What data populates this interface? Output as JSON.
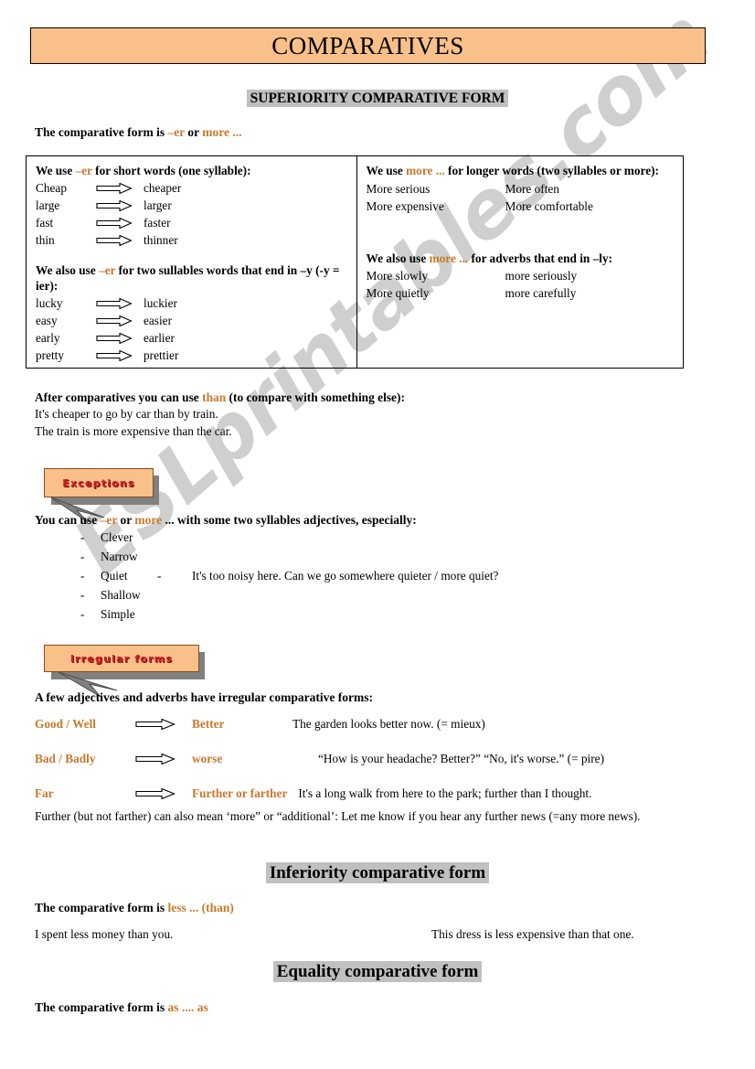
{
  "page": {
    "title": "COMPARATIVES",
    "watermark": "ESLprintables.com",
    "colors": {
      "title_bg": "#f9c08a",
      "heading_highlight": "#c0c0c0",
      "accent_orange": "#c9792b",
      "badge_bg": "#f9c08a",
      "badge_text": "#d12020",
      "shadow": "#808080"
    }
  },
  "superiority": {
    "heading": "SUPERIORITY COMPARATIVE FORM",
    "lead_prefix": "The comparative form is ",
    "lead_accent1": "–er",
    "lead_mid": " or ",
    "lead_accent2": "more ...",
    "table": {
      "left": {
        "header_part1": "We use ",
        "header_accent": "–er",
        "header_part2": " for short words (one syllable):",
        "pairs": [
          {
            "base": "Cheap",
            "comparative": "cheaper"
          },
          {
            "base": "large",
            "comparative": "larger"
          },
          {
            "base": "fast",
            "comparative": "faster"
          },
          {
            "base": "thin",
            "comparative": "thinner"
          }
        ],
        "header2_part1": "We also use ",
        "header2_accent": "–er",
        "header2_part2": " for two sullables words that end in –y (-y = ier):",
        "pairs2": [
          {
            "base": "lucky",
            "comparative": "luckier"
          },
          {
            "base": "easy",
            "comparative": "easier"
          },
          {
            "base": "early",
            "comparative": "earlier"
          },
          {
            "base": "pretty",
            "comparative": "prettier"
          }
        ]
      },
      "right": {
        "header_part1": "We use ",
        "header_accent": "more ...",
        "header_part2": " for longer words (two syllables or more):",
        "words": [
          {
            "c1": "More serious",
            "c2": "More often"
          },
          {
            "c1": "More expensive",
            "c2": "More comfortable"
          }
        ],
        "header2_part1": "We also use ",
        "header2_accent": "more ...",
        "header2_part2": " for adverbs that end in –ly:",
        "words2": [
          {
            "c1": "More slowly",
            "c2": "more seriously"
          },
          {
            "c1": "More quietly",
            "c2": "more carefully"
          }
        ]
      }
    }
  },
  "after_comparatives": {
    "lead_part1": "After comparatives you can use ",
    "lead_accent": "than",
    "lead_part2": " (to compare with something else):",
    "examples": [
      "It's cheaper to go by car than by train.",
      "The train is more expensive than the car."
    ]
  },
  "exceptions": {
    "badge_label": "Exceptions",
    "lead_part1": "You can use ",
    "lead_accent1": "–er",
    "lead_mid": " or ",
    "lead_accent2": "more",
    "lead_part2": " ... with some two syllables adjectives, especially:",
    "items": [
      {
        "dash": "-",
        "word": "Clever",
        "sep": "",
        "note": ""
      },
      {
        "dash": "-",
        "word": "Narrow",
        "sep": "",
        "note": ""
      },
      {
        "dash": "-",
        "word": "Quiet",
        "sep": "-",
        "note": "It's too noisy here. Can we go somewhere quieter / more quiet?"
      },
      {
        "dash": "-",
        "word": "Shallow",
        "sep": "",
        "note": ""
      },
      {
        "dash": "-",
        "word": "Simple",
        "sep": "",
        "note": ""
      }
    ]
  },
  "irregular": {
    "badge_label": "Irregular forms",
    "lead": "A few adjectives and adverbs have irregular comparative forms:",
    "rows": [
      {
        "base": "Good / Well",
        "comparative": "Better",
        "example": "The garden looks better now. (= mieux)"
      },
      {
        "base": "Bad / Badly",
        "comparative": "worse",
        "example": "“How is your headache? Better?” “No, it's worse.” (= pire)"
      },
      {
        "base": "Far",
        "comparative": "Further or farther",
        "example": "It's a long walk from here to the park; further than I thought."
      }
    ],
    "note": "Further (but not farther) can also mean ‘more” or “additional’: Let me know if you hear any further news (=any more news)."
  },
  "inferiority": {
    "heading": "Inferiority comparative form",
    "lead_prefix": "The comparative form is ",
    "lead_accent": "less ... (than)",
    "examples": [
      "I spent less money than you.",
      "This dress is less expensive than that one."
    ]
  },
  "equality": {
    "heading": "Equality comparative form",
    "lead_prefix": "The comparative form is ",
    "lead_accent": "as .... as"
  }
}
